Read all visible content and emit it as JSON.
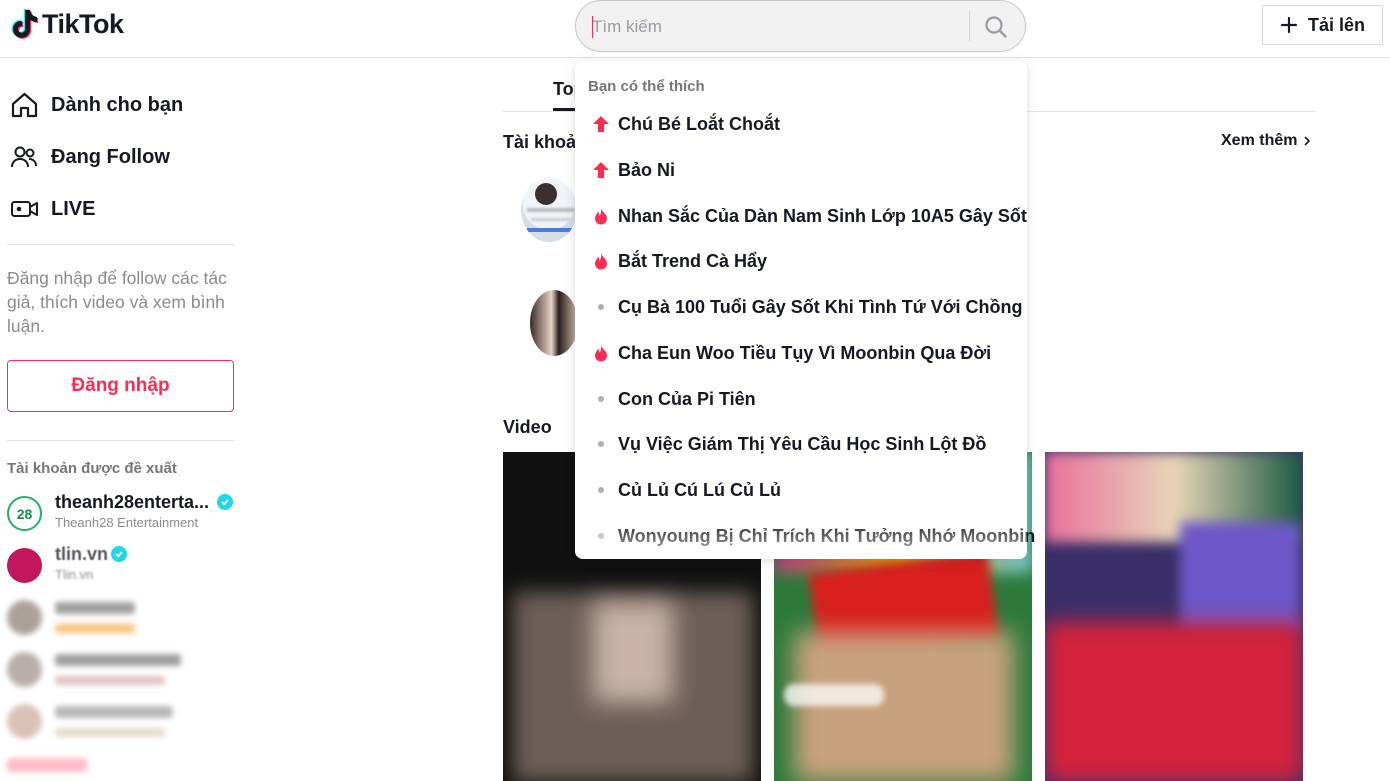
{
  "header": {
    "logo_text": "TikTok",
    "search_placeholder": "Tìm kiếm",
    "upload_label": "Tải lên"
  },
  "sidebar": {
    "nav": [
      {
        "label": "Dành cho bạn",
        "icon": "home-icon"
      },
      {
        "label": "Đang Follow",
        "icon": "users-icon"
      },
      {
        "label": "LIVE",
        "icon": "live-icon"
      }
    ],
    "login_hint": "Đăng nhập để follow các tác giả, thích video và xem bình luận.",
    "login_button": "Đăng nhập",
    "suggested_title": "Tài khoản được đề xuất",
    "accounts": [
      {
        "name": "theanh28enterta...",
        "sub": "Theanh28 Entertainment",
        "verified": true
      },
      {
        "name": "tlin.vn",
        "sub": "Tlin.vn",
        "verified": true
      }
    ]
  },
  "main": {
    "tab_top": "Top",
    "accounts_section": "Tài khoản",
    "see_more": "Xem thêm",
    "video_section": "Video"
  },
  "dropdown": {
    "title": "Bạn có thể thích",
    "items": [
      {
        "label": "Chú Bé Loắt Choắt",
        "icon": "trending-up-icon"
      },
      {
        "label": "Bảo Ni",
        "icon": "trending-up-icon"
      },
      {
        "label": "Nhan Sắc Của Dàn Nam Sinh Lớp 10A5 Gây Sốt",
        "icon": "fire-icon"
      },
      {
        "label": "Bắt Trend Cà Hẩy",
        "icon": "fire-icon"
      },
      {
        "label": "Cụ Bà 100 Tuổi Gây Sốt Khi Tình Tứ Với Chồng",
        "icon": "dot-icon"
      },
      {
        "label": "Cha Eun Woo Tiều Tụy Vì Moonbin Qua Đời",
        "icon": "fire-icon"
      },
      {
        "label": "Con Của Pi Tiên",
        "icon": "dot-icon"
      },
      {
        "label": "Vụ Việc Giám Thị Yêu Cầu Học Sinh Lột Đồ",
        "icon": "dot-icon"
      },
      {
        "label": "Củ Lủ Cú Lú Củ Lủ",
        "icon": "dot-icon"
      },
      {
        "label": "Wonyoung Bị Chỉ Trích Khi Tưởng Nhớ Moonbin",
        "icon": "dot-icon"
      }
    ]
  },
  "colors": {
    "brand": "#fe2c55",
    "text": "#161823",
    "muted": "#8a8b91",
    "verified": "#20d5ec"
  }
}
